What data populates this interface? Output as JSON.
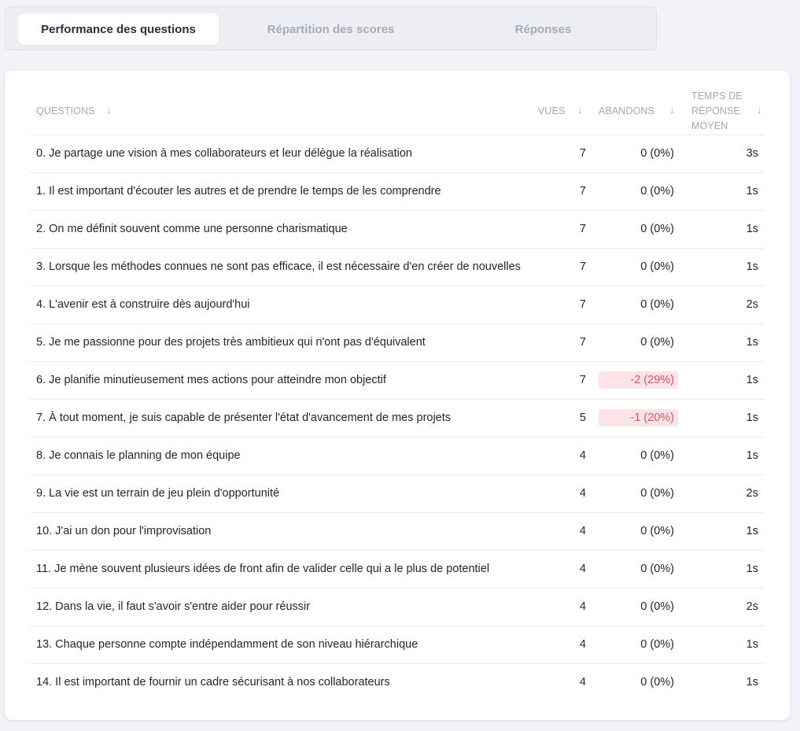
{
  "tabs": [
    {
      "label": "Performance des questions",
      "active": true
    },
    {
      "label": "Répartition des scores",
      "active": false
    },
    {
      "label": "Réponses",
      "active": false
    }
  ],
  "table": {
    "headers": {
      "questions": "QUESTIONS",
      "vues": "VUES",
      "abandons": "ABANDONS",
      "temps_line1": "TEMPS DE",
      "temps_line2": "RÉPONSE",
      "temps_line3": "MOYEN",
      "sort_icon": "↓"
    },
    "rows": [
      {
        "question": "0. Je partage une vision à mes collaborateurs et leur délègue la réalisation",
        "vues": "7",
        "abandons": "0 (0%)",
        "temps": "3s",
        "negative": false
      },
      {
        "question": "1. Il est important d'écouter les autres et de prendre le temps de les comprendre",
        "vues": "7",
        "abandons": "0 (0%)",
        "temps": "1s",
        "negative": false
      },
      {
        "question": "2. On me définit souvent comme une personne charismatique",
        "vues": "7",
        "abandons": "0 (0%)",
        "temps": "1s",
        "negative": false
      },
      {
        "question": "3. Lorsque les méthodes connues ne sont pas efficace, il est nécessaire d'en créer de nouvelles",
        "vues": "7",
        "abandons": "0 (0%)",
        "temps": "1s",
        "negative": false
      },
      {
        "question": "4. L'avenir est à construire dès aujourd'hui",
        "vues": "7",
        "abandons": "0 (0%)",
        "temps": "2s",
        "negative": false
      },
      {
        "question": "5. Je me passionne pour des projets très ambitieux qui n'ont pas d'équivalent",
        "vues": "7",
        "abandons": "0 (0%)",
        "temps": "1s",
        "negative": false
      },
      {
        "question": "6. Je planifie minutieusement mes actions pour atteindre mon objectif",
        "vues": "7",
        "abandons": "-2 (29%)",
        "temps": "1s",
        "negative": true
      },
      {
        "question": "7. À tout moment, je suis capable de présenter l'état d'avancement de mes projets",
        "vues": "5",
        "abandons": "-1 (20%)",
        "temps": "1s",
        "negative": true
      },
      {
        "question": "8. Je connais le planning de mon équipe",
        "vues": "4",
        "abandons": "0 (0%)",
        "temps": "1s",
        "negative": false
      },
      {
        "question": "9. La vie est un terrain de jeu plein d'opportunité",
        "vues": "4",
        "abandons": "0 (0%)",
        "temps": "2s",
        "negative": false
      },
      {
        "question": "10. J'ai un don pour l'improvisation",
        "vues": "4",
        "abandons": "0 (0%)",
        "temps": "1s",
        "negative": false
      },
      {
        "question": "11. Je mène souvent plusieurs idées de front afin de valider celle qui a le plus de potentiel",
        "vues": "4",
        "abandons": "0 (0%)",
        "temps": "1s",
        "negative": false
      },
      {
        "question": "12. Dans la vie, il faut s'avoir s'entre aider pour réussir",
        "vues": "4",
        "abandons": "0 (0%)",
        "temps": "2s",
        "negative": false
      },
      {
        "question": "13. Chaque personne compte indépendamment de son niveau hiérarchique",
        "vues": "4",
        "abandons": "0 (0%)",
        "temps": "1s",
        "negative": false
      },
      {
        "question": "14. Il est important de fournir un cadre sécurisant à nos collaborateurs",
        "vues": "4",
        "abandons": "0 (0%)",
        "temps": "1s",
        "negative": false
      }
    ]
  },
  "colors": {
    "negative_bg": "#fce3e6",
    "negative_text": "#e0536a",
    "page_bg": "#f2f3f8"
  }
}
